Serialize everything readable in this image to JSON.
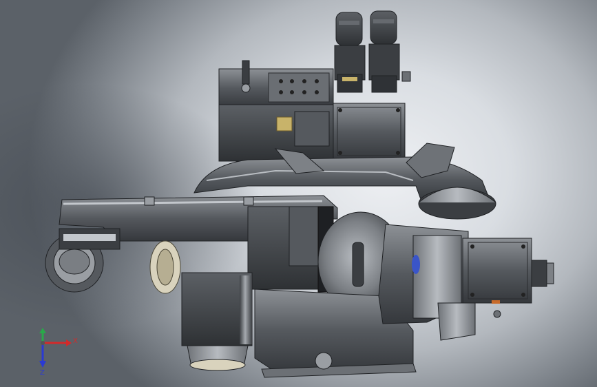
{
  "viewport": {
    "background_center": "#eef0f3",
    "background_edge": "#5b6168",
    "model": {
      "body_color": "#4a4d51",
      "highlight_color": "#9a9ea3",
      "accent_color": "#2f3236",
      "connector_color": "#2a2c2f",
      "brass_color": "#c8b36a",
      "blue_accent": "#3a55c8",
      "pulley_color": "#d9d3bd"
    }
  },
  "triad": {
    "x_label": "X",
    "y_label": "Y",
    "z_label": "Z",
    "x_color": "#d42a2a",
    "y_color": "#2aa84a",
    "z_color": "#2a3ad4"
  }
}
